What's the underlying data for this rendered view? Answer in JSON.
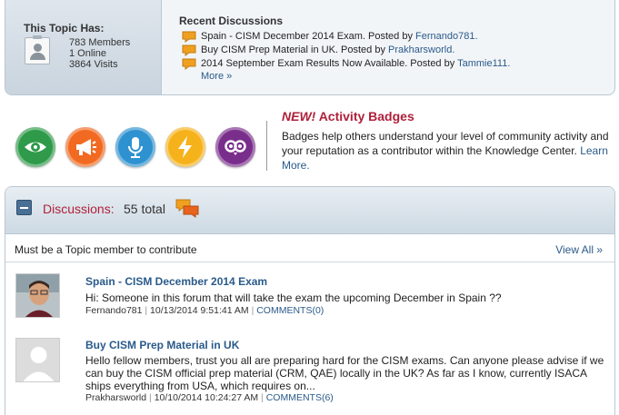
{
  "topic": {
    "has_title": "This Topic Has:",
    "members": "783 Members",
    "online": "1 Online",
    "visits": "3864 Visits"
  },
  "recent": {
    "title": "Recent Discussions",
    "items": [
      {
        "text": "Spain - CISM December 2014 Exam. Posted by ",
        "author": "Fernando781."
      },
      {
        "text": "Buy CISM Prep Material in UK. Posted by ",
        "author": "Prakharsworld."
      },
      {
        "text": "2014 September Exam Results Now Available. Posted by ",
        "author": "Tammie111."
      }
    ],
    "more": "More »"
  },
  "badges": {
    "title_new": "NEW!",
    "title_rest": " Activity Badges",
    "description": "Badges help others understand your level of community activity and your reputation as a contributor within the Knowledge Center. ",
    "learn_more": "Learn More.",
    "icons": [
      {
        "name": "eye-badge-icon",
        "color": "#2e9a4a"
      },
      {
        "name": "megaphone-badge-icon",
        "color": "#f26a22"
      },
      {
        "name": "microphone-badge-icon",
        "color": "#2f92d0"
      },
      {
        "name": "lightning-badge-icon",
        "color": "#f6b21b"
      },
      {
        "name": "owl-badge-icon",
        "color": "#7a2e8c"
      }
    ]
  },
  "discussions": {
    "title": "Discussions:",
    "total": "55 total",
    "member_note": "Must be a Topic member to contribute",
    "view_all": "View All »",
    "posts": [
      {
        "title": "Spain - CISM December 2014 Exam",
        "body": "Hi: Someone in this forum that will take the exam the upcoming December in Spain ??",
        "author": "Fernando781",
        "date": "10/13/2014 9:51:41 AM",
        "comments": "COMMENTS(0)"
      },
      {
        "title": "Buy CISM Prep Material in UK",
        "body": "Hello fellow members, trust you all are preparing hard for the CISM exams. Can anyone please advise if we can buy the CISM official prep material (CRM, QAE) locally in the UK? As far as I know, currently ISACA ships everything from USA, which requires on...",
        "author": "Prakharsworld",
        "date": "10/10/2014 10:24:27 AM",
        "comments": "COMMENTS(6)"
      }
    ]
  },
  "colors": {
    "accent_red": "#b01f3a",
    "link_blue": "#2a5a8a",
    "bubble_orange": "#f0a020"
  }
}
